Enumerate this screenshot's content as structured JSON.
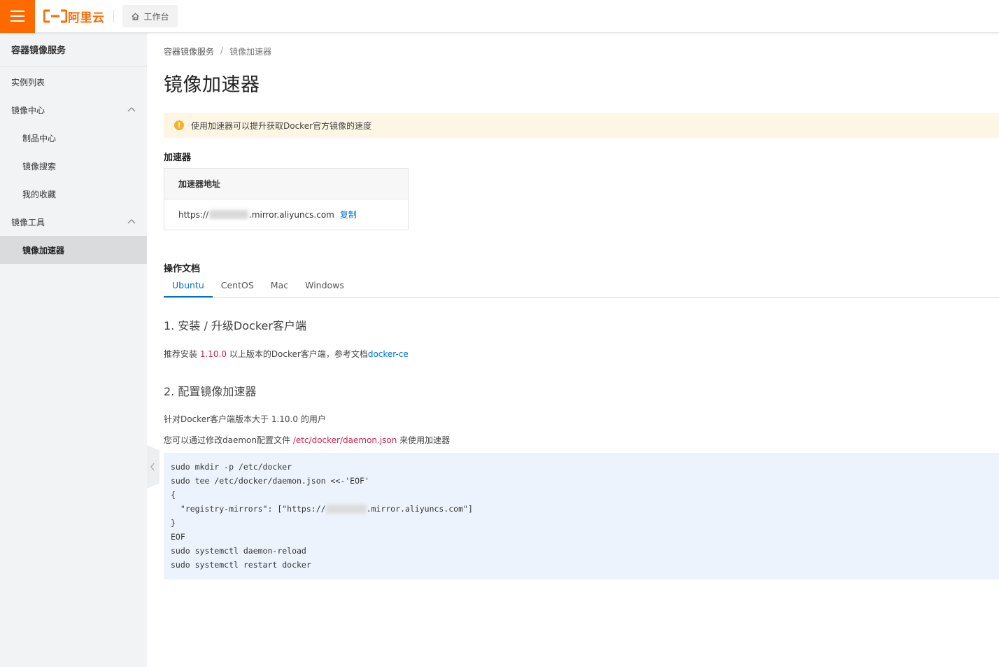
{
  "colors": {
    "brand": "#ff6a00",
    "link": "#0070cc",
    "accent_red": "#c7254e",
    "warning": "#f6b22b"
  },
  "topbar": {
    "menu_icon": "hamburger-icon",
    "logo_text": "阿里云",
    "workbench_icon": "home-icon",
    "workbench_label": "工作台"
  },
  "sidebar": {
    "title": "容器镜像服务",
    "items": [
      {
        "label": "实例列表"
      },
      {
        "label": "镜像中心",
        "icon": "chevron-up-icon"
      },
      {
        "label": "制品中心"
      },
      {
        "label": "镜像搜索"
      },
      {
        "label": "我的收藏"
      },
      {
        "label": "镜像工具",
        "icon": "chevron-up-icon"
      },
      {
        "label": "镜像加速器",
        "active": true
      }
    ],
    "collapse_icon": "chevron-left-icon"
  },
  "breadcrumb": {
    "items": [
      "容器镜像服务",
      "镜像加速器"
    ],
    "separator": "/"
  },
  "page": {
    "title": "镜像加速器",
    "notice": "使用加速器可以提升获取Docker官方镜像的速度"
  },
  "accelerator": {
    "heading": "加速器",
    "column_header": "加速器地址",
    "address_prefix": "https://",
    "address_suffix": ".mirror.aliyuncs.com",
    "copy_label": "复制"
  },
  "docs": {
    "heading": "操作文档",
    "tabs": [
      "Ubuntu",
      "CentOS",
      "Mac",
      "Windows"
    ],
    "active_tab": "Ubuntu",
    "step1": {
      "title": "1. 安装 / 升级Docker客户端",
      "text_before": "推荐安装 ",
      "version": "1.10.0",
      "text_after": " 以上版本的Docker客户端，参考文档",
      "link": "docker-ce"
    },
    "step2": {
      "title": "2. 配置镜像加速器",
      "line1": "针对Docker客户端版本大于 1.10.0 的用户",
      "line2_before": "您可以通过修改daemon配置文件 ",
      "line2_path": "/etc/docker/daemon.json",
      "line2_after": " 来使用加速器",
      "code": {
        "l1": "sudo mkdir -p /etc/docker",
        "l2": "sudo tee /etc/docker/daemon.json <<-'EOF'",
        "l3": "{",
        "l4_before": "  \"registry-mirrors\": [\"https://",
        "l4_after": ".mirror.aliyuncs.com\"]",
        "l5": "}",
        "l6": "EOF",
        "l7": "sudo systemctl daemon-reload",
        "l8": "sudo systemctl restart docker"
      }
    }
  }
}
